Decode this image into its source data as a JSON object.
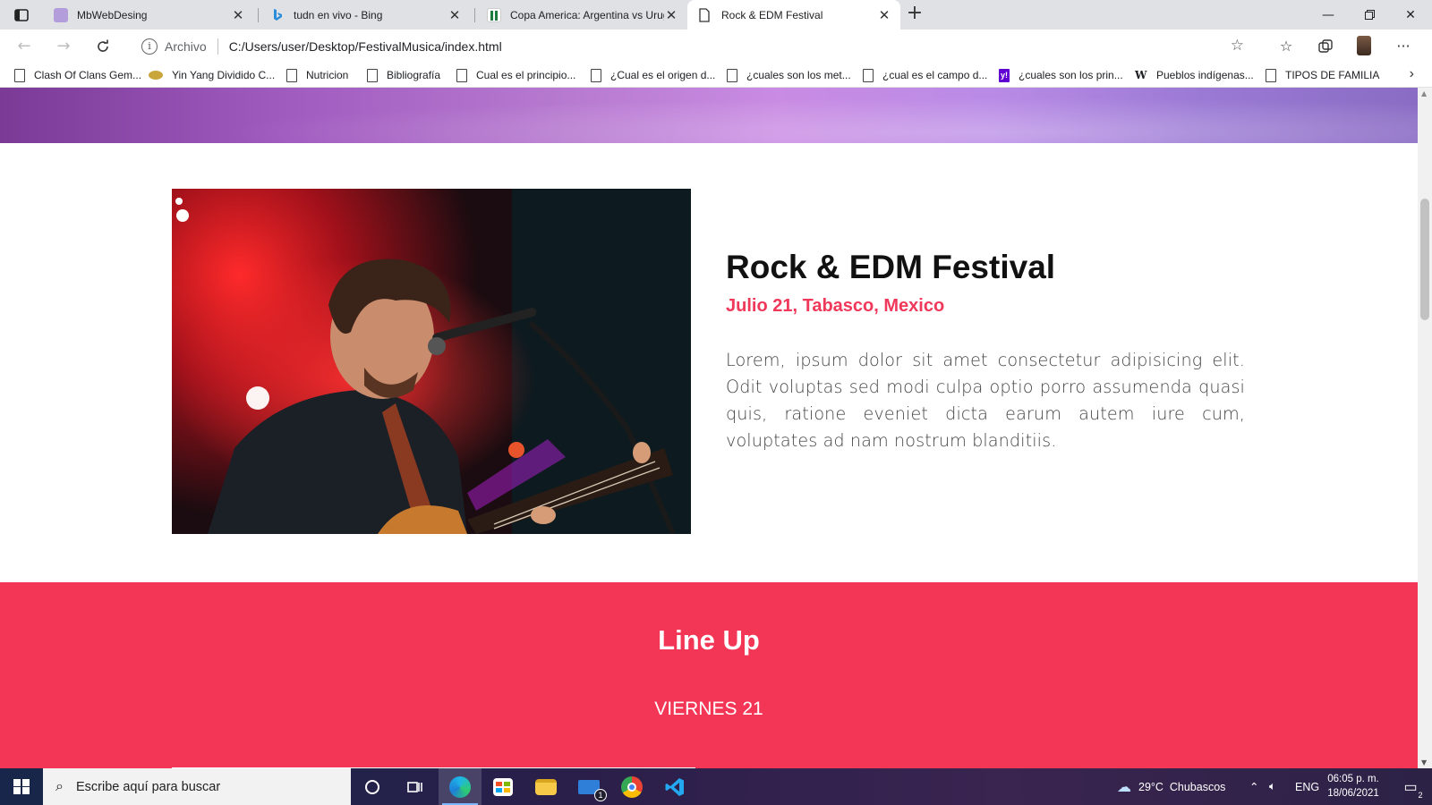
{
  "browser": {
    "tabs": [
      {
        "title": "MbWebDesing",
        "active": false,
        "favicon_color": "#b39ddb"
      },
      {
        "title": "tudn en vivo - Bing",
        "active": false,
        "favicon_color": "#2b8cd9"
      },
      {
        "title": "Copa America: Argentina vs Urug",
        "active": false,
        "favicon_color": "#1a7a3f"
      },
      {
        "title": "Rock & EDM Festival",
        "active": true,
        "favicon_color": "#ffffff"
      }
    ],
    "address": {
      "scheme_label": "Archivo",
      "url": "C:/Users/user/Desktop/FestivalMusica/index.html"
    },
    "bookmarks": [
      {
        "label": "Clash Of Clans Gem...",
        "icon": "page-icon"
      },
      {
        "label": "Yin Yang Dividido C...",
        "icon": "yin-yang-icon"
      },
      {
        "label": "Nutricion",
        "icon": "page-icon"
      },
      {
        "label": "Bibliografía",
        "icon": "page-icon"
      },
      {
        "label": "Cual es el principio...",
        "icon": "page-icon"
      },
      {
        "label": "¿Cual es el origen d...",
        "icon": "page-icon"
      },
      {
        "label": "¿cuales son los met...",
        "icon": "page-icon"
      },
      {
        "label": "¿cual es el campo d...",
        "icon": "page-icon"
      },
      {
        "label": "¿cuales son los prin...",
        "icon": "yahoo-icon"
      },
      {
        "label": "Pueblos indígenas...",
        "icon": "wikipedia-icon"
      },
      {
        "label": "TIPOS DE FAMILIA",
        "icon": "page-icon"
      }
    ]
  },
  "page": {
    "event": {
      "title": "Rock & EDM Festival",
      "meta": "Julio 21, Tabasco, Mexico",
      "description": "Lorem, ipsum dolor sit amet consectetur adipisicing elit. Odit voluptas sed modi culpa optio porro assumenda quasi quis, ratione eveniet dicta earum autem iure cum, voluptates ad nam nostrum blanditiis."
    },
    "lineup": {
      "title": "Line Up",
      "day": "VIERNES 21"
    },
    "colors": {
      "accent": "#f33656",
      "hero_purple": "#b77ad0"
    }
  },
  "taskbar": {
    "search_placeholder": "Escribe aquí para buscar",
    "weather": "29°C  Chubascos",
    "language": "ENG",
    "time": "06:05 p. m.",
    "date": "18/06/2021",
    "notification_count": "2",
    "mail_badge": "1"
  }
}
